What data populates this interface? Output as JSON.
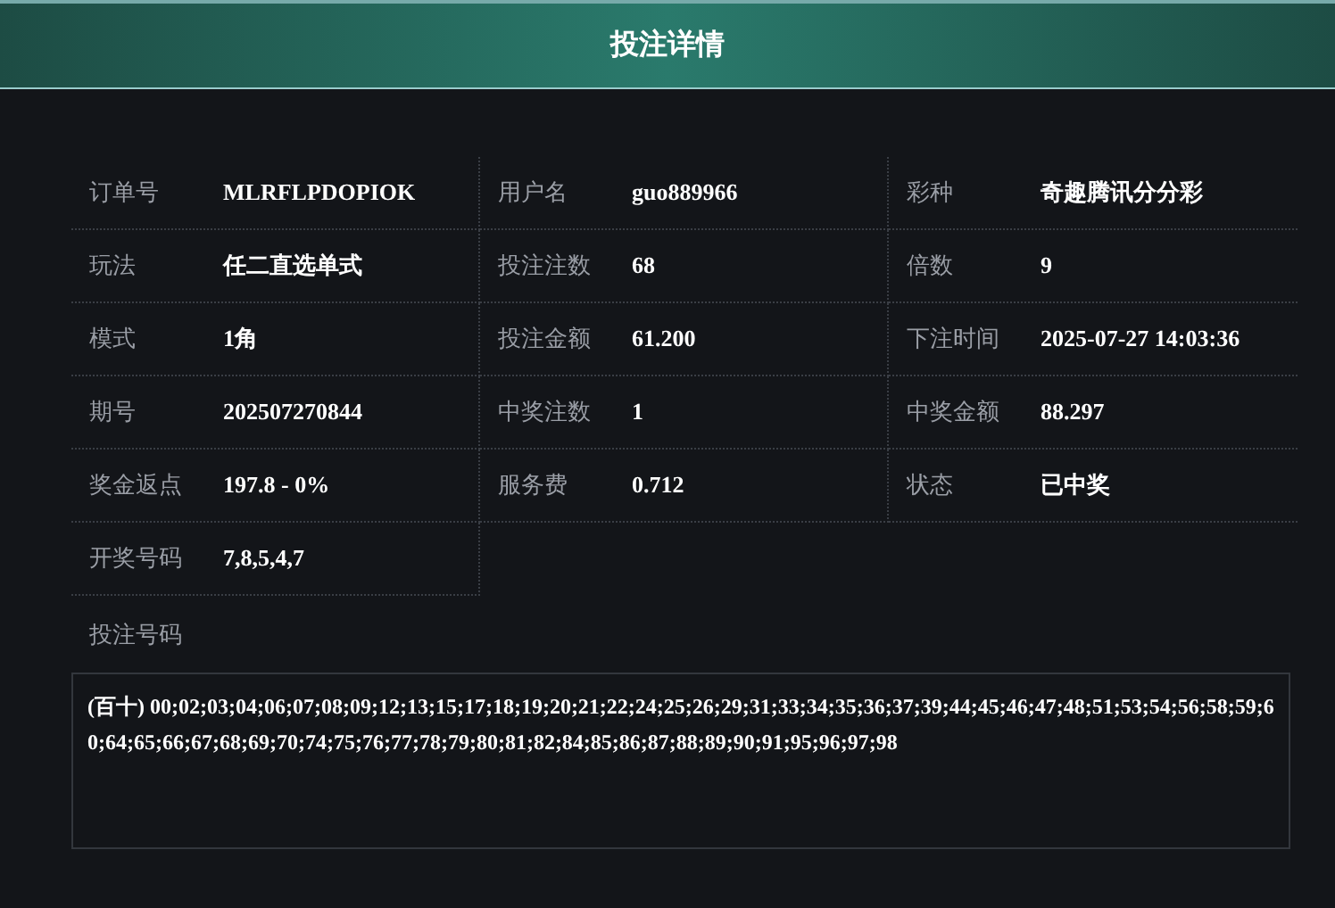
{
  "header": {
    "title": "投注详情"
  },
  "fields": [
    {
      "label": "订单号",
      "value": "MLRFLPDOPIOK"
    },
    {
      "label": "用户名",
      "value": "guo889966"
    },
    {
      "label": "彩种",
      "value": "奇趣腾讯分分彩"
    },
    {
      "label": "玩法",
      "value": "任二直选单式"
    },
    {
      "label": "投注注数",
      "value": "68"
    },
    {
      "label": "倍数",
      "value": "9"
    },
    {
      "label": "模式",
      "value": "1角"
    },
    {
      "label": "投注金额",
      "value": "61.200"
    },
    {
      "label": "下注时间",
      "value": "2025-07-27 14:03:36"
    },
    {
      "label": "期号",
      "value": "202507270844"
    },
    {
      "label": "中奖注数",
      "value": "1"
    },
    {
      "label": "中奖金额",
      "value": "88.297"
    },
    {
      "label": "奖金返点",
      "value": "197.8 - 0%"
    },
    {
      "label": "服务费",
      "value": "0.712"
    },
    {
      "label": "状态",
      "value": "已中奖"
    },
    {
      "label": "开奖号码",
      "value": "7,8,5,4,7"
    }
  ],
  "bet_numbers": {
    "label": "投注号码",
    "value": "(百十) 00;02;03;04;06;07;08;09;12;13;15;17;18;19;20;21;22;24;25;26;29;31;33;34;35;36;37;39;44;45;46;47;48;51;53;54;56;58;59;60;64;65;66;67;68;69;70;74;75;76;77;78;79;80;81;82;84;85;86;87;88;89;90;91;95;96;97;98"
  }
}
